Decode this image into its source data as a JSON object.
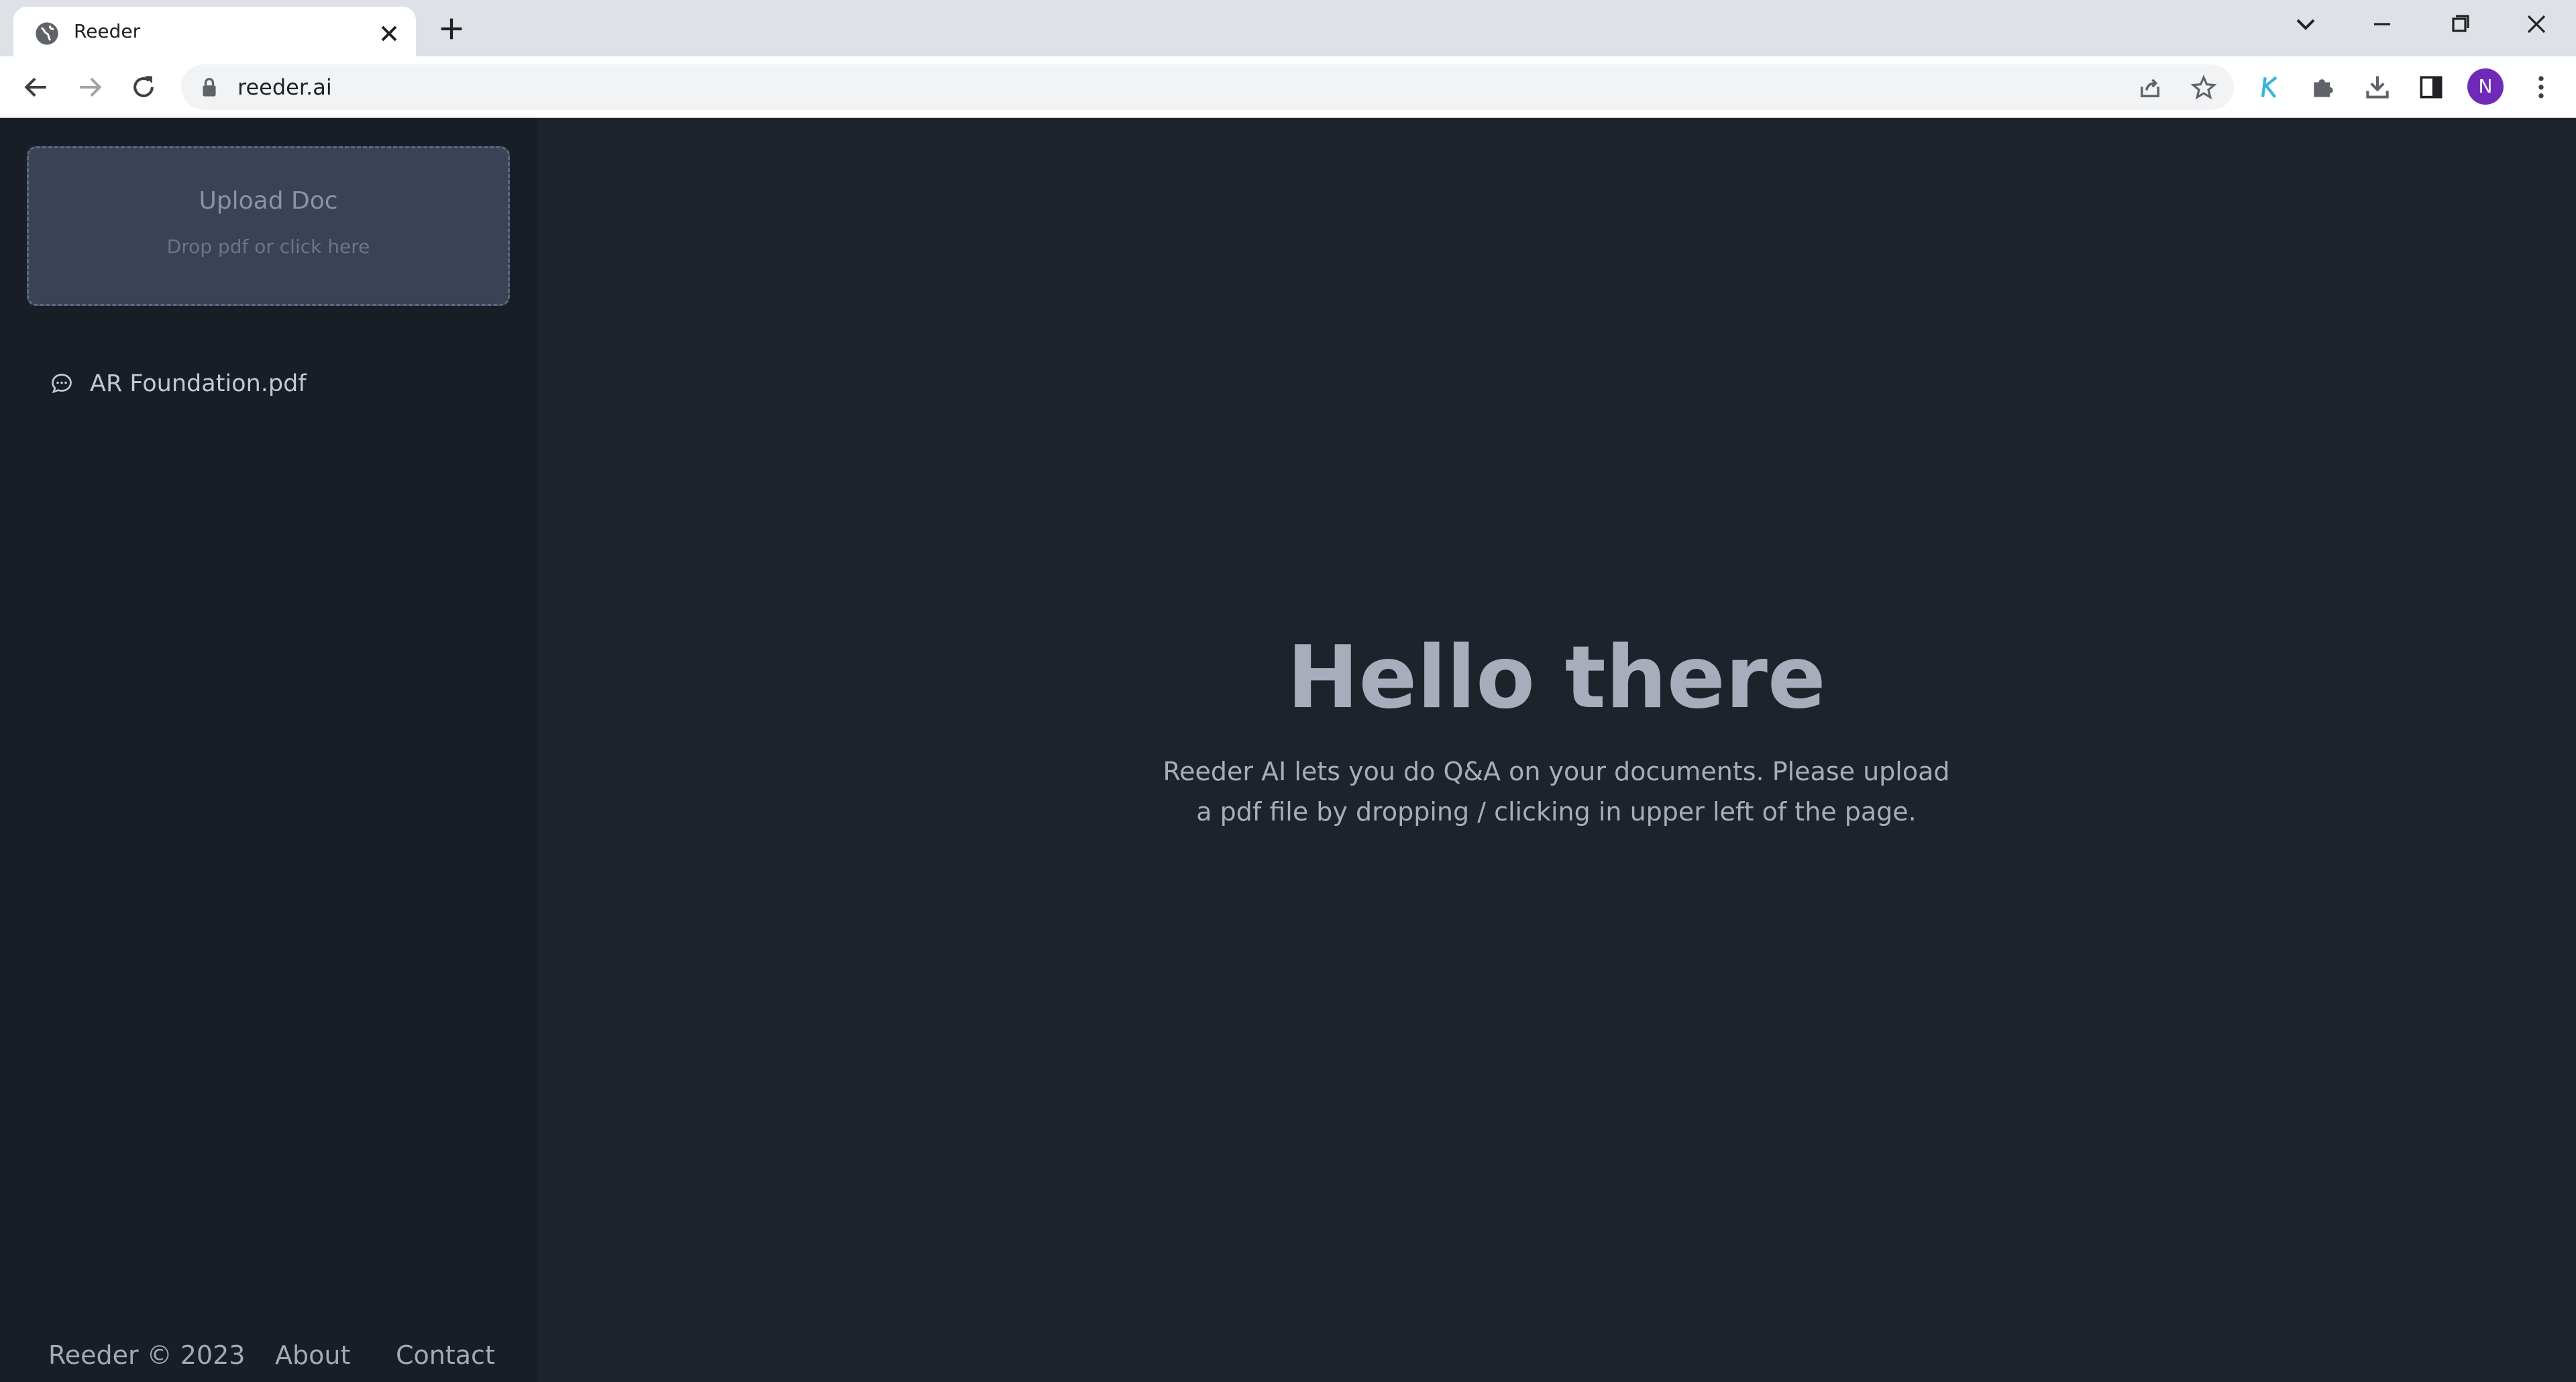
{
  "browser": {
    "tab_title": "Reeder",
    "url": "reeder.ai",
    "profile_initial": "N"
  },
  "sidebar": {
    "upload": {
      "title": "Upload Doc",
      "subtitle": "Drop pdf or click here"
    },
    "documents": [
      {
        "name": "AR Foundation.pdf"
      }
    ],
    "footer": {
      "copyright": "Reeder © 2023",
      "about": "About",
      "contact": "Contact"
    }
  },
  "main": {
    "heading": "Hello there",
    "intro_line1": "Reeder AI lets you do Q&A on your documents. Please upload",
    "intro_line2": "a pdf file by dropping / clicking in upper left of the page."
  },
  "colors": {
    "sidebar_bg": "#191d26",
    "main_bg": "#1e222b",
    "upload_bg": "#3a4256",
    "avatar": "#6f2bb8"
  }
}
